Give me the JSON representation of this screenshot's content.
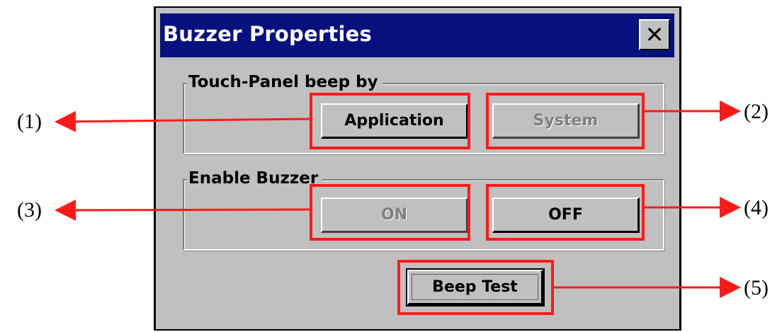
{
  "window": {
    "title": "Buzzer Properties",
    "close_glyph": "✕"
  },
  "groups": {
    "touch_panel": {
      "label": "Touch-Panel beep by",
      "application_label": "Application",
      "system_label": "System"
    },
    "enable_buzzer": {
      "label": "Enable Buzzer",
      "on_label": "ON",
      "off_label": "OFF"
    }
  },
  "beep_test_label": "Beep Test",
  "annotations": [
    "(1)",
    "(2)",
    "(3)",
    "(4)",
    "(5)"
  ],
  "colors": {
    "highlight": "#ff1a1a",
    "titlebar": "#08107e",
    "dialog_bg": "#c0c0c0"
  }
}
